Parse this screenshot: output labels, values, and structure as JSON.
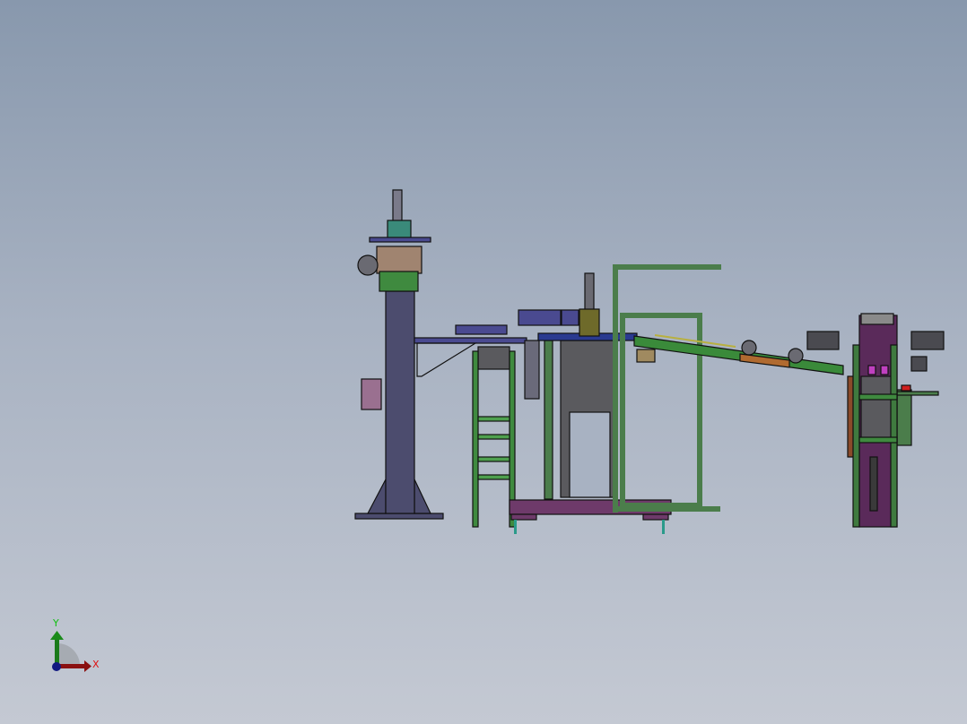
{
  "viewport": {
    "background_top": "#8898ad",
    "background_bottom": "#c4c9d3"
  },
  "triad": {
    "x_label": "X",
    "y_label": "Y",
    "x_color": "#e01010",
    "y_color": "#10c010",
    "z_color": "#1020a0"
  },
  "model_colors": {
    "column": "#4c4c6e",
    "frame_green": "#4b7d4b",
    "base_purple": "#6e3a6a",
    "press_gray": "#5a5a5e",
    "conveyor_green": "#3a8a3a",
    "blue_parts": "#4a4a90"
  }
}
